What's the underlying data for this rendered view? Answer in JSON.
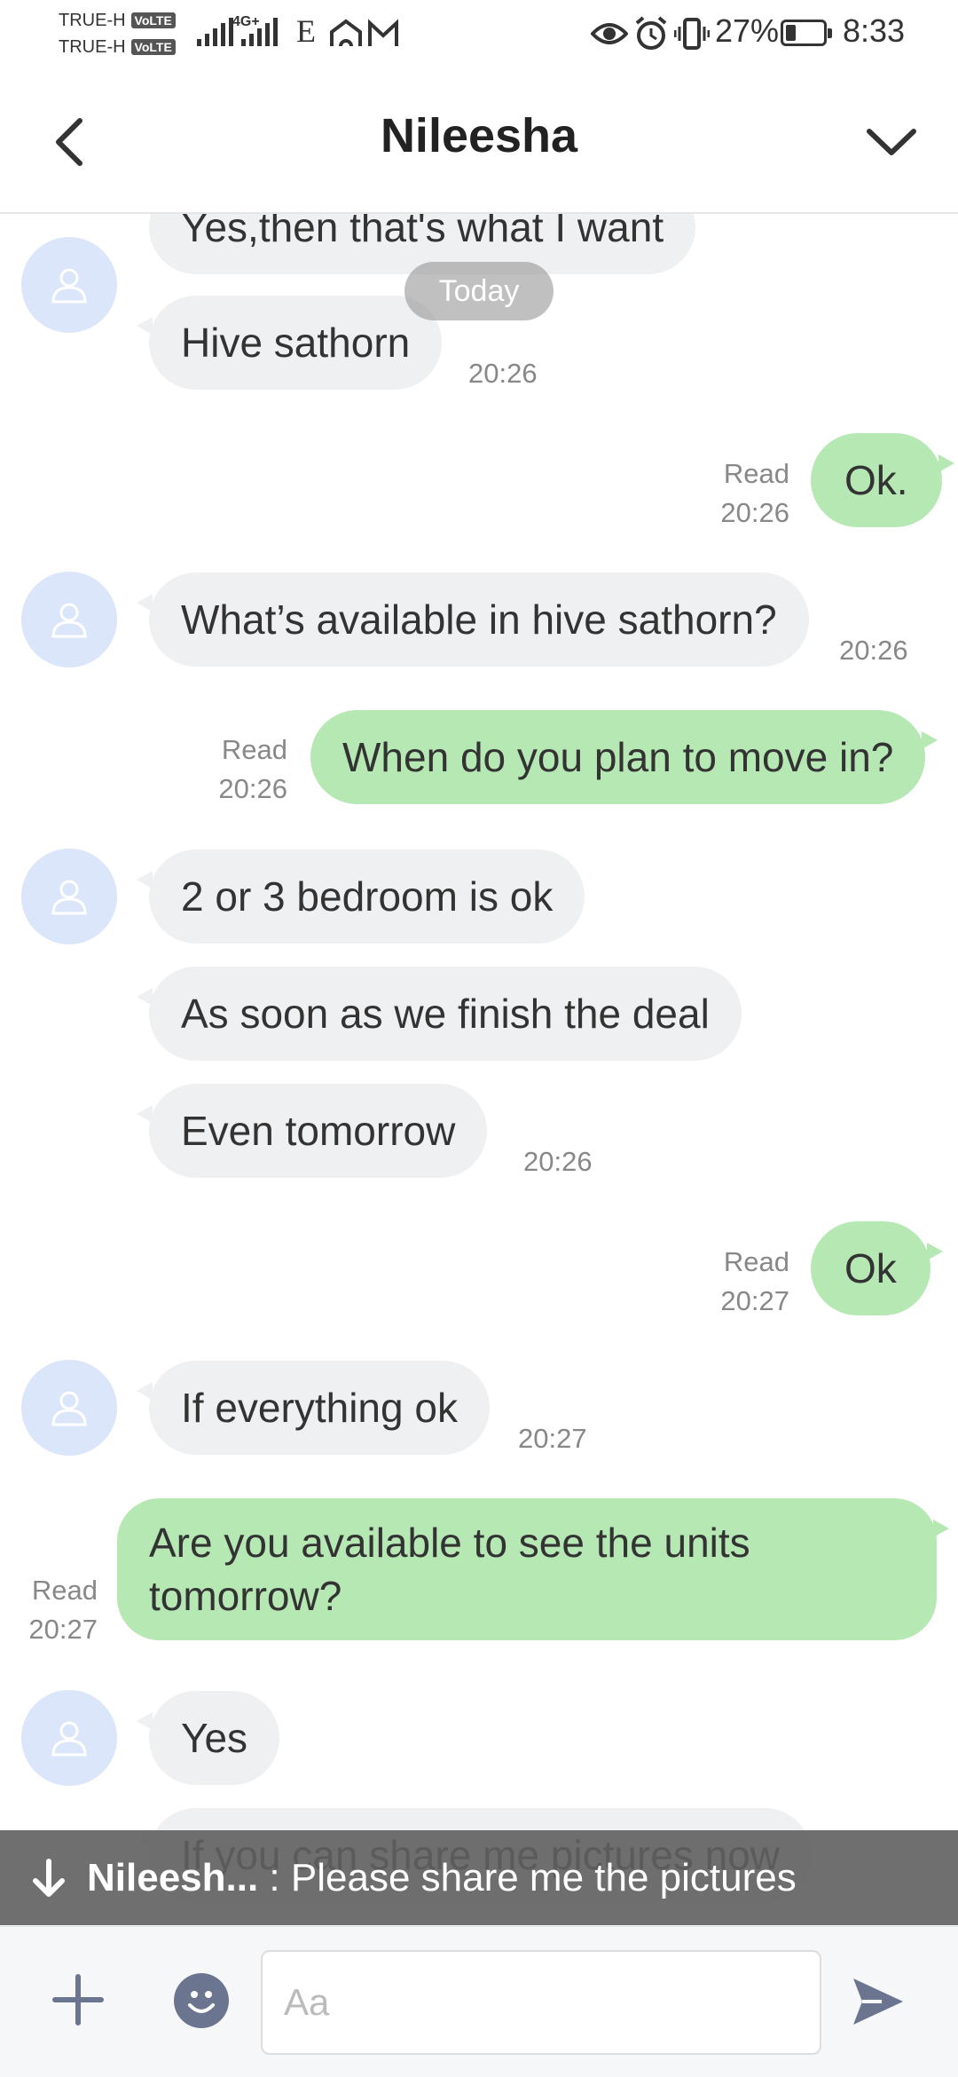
{
  "status_bar": {
    "carrier1": "TRUE-H",
    "carrier2": "TRUE-H",
    "volte": "VoLTE",
    "network_type": "4G+",
    "edge": "E",
    "battery_percent": "27%",
    "battery_level": 0.27,
    "time": "8:33"
  },
  "header": {
    "title": "Nileesha"
  },
  "chat": {
    "date_separator": "Today",
    "messages": [
      {
        "dir": "in",
        "text": "Yes,then that's what I want"
      },
      {
        "dir": "in",
        "text": "Hive sathorn",
        "time": "20:26"
      },
      {
        "dir": "out",
        "text": "Ok.",
        "read": "Read",
        "time": "20:26"
      },
      {
        "dir": "in",
        "text": "What’s available in hive sathorn?",
        "time": "20:26"
      },
      {
        "dir": "out",
        "text": "When do you plan to move in?",
        "read": "Read",
        "time": "20:26"
      },
      {
        "dir": "in",
        "text": "2 or 3 bedroom is ok"
      },
      {
        "dir": "in",
        "text": "As soon as we finish the deal"
      },
      {
        "dir": "in",
        "text": "Even tomorrow",
        "time": "20:26"
      },
      {
        "dir": "out",
        "text": "Ok",
        "read": "Read",
        "time": "20:27"
      },
      {
        "dir": "in",
        "text": "If everything ok",
        "time": "20:27"
      },
      {
        "dir": "out",
        "text": "Are you available to see the units tomorrow?",
        "read": "Read",
        "time": "20:27"
      },
      {
        "dir": "in",
        "text": "Yes"
      },
      {
        "dir": "in",
        "text": "If you can share me pictures now"
      }
    ]
  },
  "banner": {
    "sender": "Nileesh...",
    "separator": " : ",
    "text": "Please share me the pictures"
  },
  "input": {
    "placeholder": "Aa"
  },
  "colors": {
    "incoming_bubble": "#eff0f2",
    "outgoing_bubble": "#b6e8b4",
    "avatar_bg": "#dbe6fb",
    "banner_bg": "#5f5f5f",
    "icon_accent": "#6b7590"
  }
}
